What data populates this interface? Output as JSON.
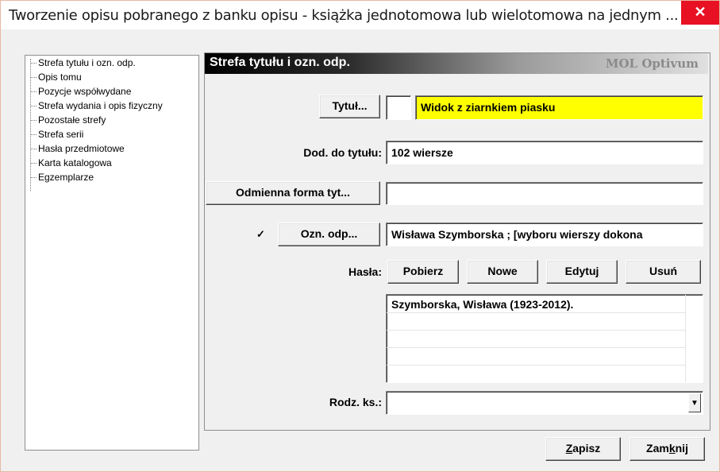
{
  "window": {
    "title": "Tworzenie opisu pobranego z banku opisu - książka jednotomowa lub wielotomowa na jednym ...",
    "close_glyph": "✕"
  },
  "tree": {
    "items": [
      {
        "label": "Strefa tytułu i ozn. odp."
      },
      {
        "label": "Opis tomu"
      },
      {
        "label": "Pozycje współwydane"
      },
      {
        "label": "Strefa wydania i opis fizyczny"
      },
      {
        "label": "Pozostałe strefy"
      },
      {
        "label": "Strefa serii"
      },
      {
        "label": "Hasła przedmiotowe"
      },
      {
        "label": "Karta katalogowa"
      },
      {
        "label": "Egzemplarze"
      }
    ]
  },
  "header": {
    "title": "Strefa tytułu i ozn. odp.",
    "brand": "MOL Optivum"
  },
  "form": {
    "tytul_button": "Tytuł...",
    "tytul_prefix": "",
    "tytul_value": "Widok z ziarnkiem piasku",
    "dod_label": "Dod. do tytułu:",
    "dod_value": "102 wiersze",
    "odmienna_button": "Odmienna forma tyt...",
    "odmienna_value": "",
    "ozn_checked": true,
    "ozn_check_glyph": "✓",
    "ozn_button": "Ozn. odp...",
    "ozn_value": "Wisława Szymborska ; [wyboru wierszy dokona",
    "hasla_label": "Hasła:",
    "pobierz_button": "Pobierz",
    "nowe_button": "Nowe",
    "edytuj_button": "Edytuj",
    "usun_button": "Usuń",
    "hasla_rows": [
      "Szymborska, Wisława (1923-2012).",
      "",
      "",
      ""
    ],
    "rodz_label": "Rodz. ks.:",
    "rodz_value": "",
    "dropdown_glyph": "▼"
  },
  "footer": {
    "zapisz_underlined": "Z",
    "zapisz_rest": "apisz",
    "zamknij_pre": "Zam",
    "zamknij_underlined": "k",
    "zamknij_rest": "nij"
  },
  "colors": {
    "title_highlight": "#ffff00",
    "close_bg": "#e81123"
  }
}
